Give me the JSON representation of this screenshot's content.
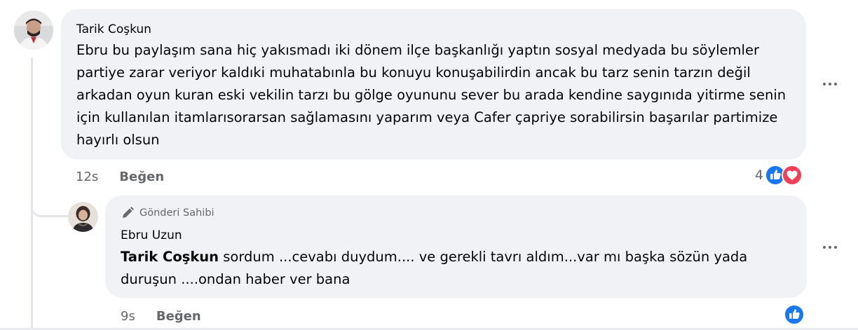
{
  "comments": [
    {
      "author": "Tarik Coşkun",
      "text": "Ebru bu paylaşım sana hiç yakısmadı iki dönem ilçe başkanlığı yaptın sosyal medyada bu söylemler partiye zarar veriyor kaldıki muhatabınla bu konuyu konuşabilirdin ancak bu tarz senin tarzın değil arkadan oyun kuran eski vekilin tarzı bu gölge oyununu sever bu arada kendine saygınıda yitirme senin için kullanılan itamlarısorarsan sağlamasını yaparım veya Cafer çapriye sorabilirsin başarılar partimize hayırlı olsun",
      "time": "12s",
      "like_label": "Beğen",
      "reaction_count": "4",
      "reactions": [
        "like-icon",
        "love-icon"
      ]
    }
  ],
  "reply": {
    "badge": "Gönderi Sahibi",
    "author": "Ebru Uzun",
    "mention": "Tarik Coşkun",
    "text": " sordum ...cevabı duydum.... ve gerekli tavrı aldım...var mı başka sözün yada duruşun ....ondan haber ver bana",
    "time": "9s",
    "like_label": "Beğen",
    "reactions": [
      "like-icon"
    ]
  },
  "colors": {
    "bubble": "#f0f2f5",
    "secondary_text": "#65676b",
    "like_blue": "#1877f2",
    "love_red": "#f33e58"
  }
}
